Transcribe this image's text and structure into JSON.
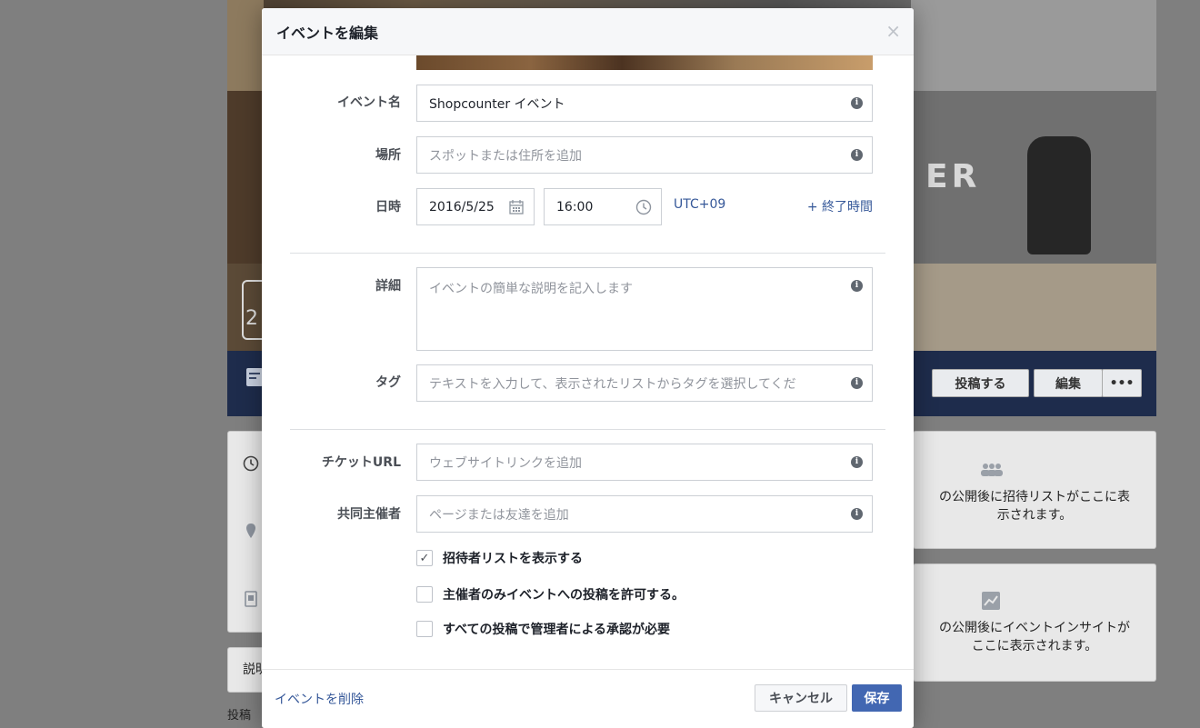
{
  "background_page": {
    "cover_letter": "ER",
    "date_digit": "2",
    "post_button": "投稿する",
    "edit_button": "編集",
    "more_button": "•••",
    "invite_list_note": "の公開後に招待リストがここに表示されます。",
    "invite_list_note_line1": "の公開後に招待リストがここに表",
    "invite_list_note_line2": "示されます。",
    "insight_note_line1": "の公開後にイベントインサイトが",
    "insight_note_line2": "ここに表示されます。",
    "left_card_label": "説明",
    "posts_label": "投稿"
  },
  "dialog": {
    "title": "イベントを編集",
    "close_glyph": "×",
    "fields": {
      "event_name": {
        "label": "イベント名",
        "value": "Shopcounter イベント"
      },
      "place": {
        "label": "場所",
        "placeholder": "スポットまたは住所を追加"
      },
      "datetime": {
        "label": "日時",
        "date": "2016/5/25",
        "time": "16:00",
        "timezone": "UTC+09",
        "end_time_link": "+ 終了時間"
      },
      "details": {
        "label": "詳細",
        "placeholder": "イベントの簡単な説明を記入します"
      },
      "tags": {
        "label": "タグ",
        "placeholder": "テキストを入力して、表示されたリストからタグを選択してくだ"
      },
      "ticket_url": {
        "label": "チケットURL",
        "placeholder": "ウェブサイトリンクを追加"
      },
      "cohosts": {
        "label": "共同主催者",
        "placeholder": "ページまたは友達を追加"
      }
    },
    "info_glyph": "i",
    "checkboxes": [
      {
        "label": "招待者リストを表示する",
        "checked": true,
        "glyph": "✓"
      },
      {
        "label": "主催者のみイベントへの投稿を許可する。",
        "checked": false,
        "glyph": ""
      },
      {
        "label": "すべての投稿で管理者による承認が必要",
        "checked": false,
        "glyph": ""
      }
    ],
    "footer": {
      "delete_link": "イベントを削除",
      "cancel_button": "キャンセル",
      "save_button": "保存"
    }
  },
  "colors": {
    "link": "#365899",
    "primary_button": "#4267b2",
    "overlay_bg": "#7f7f7f"
  },
  "icons": {
    "calendar": "calendar-icon",
    "clock": "clock-icon",
    "info": "info-icon",
    "close": "close-icon",
    "check": "checkmark-icon"
  }
}
